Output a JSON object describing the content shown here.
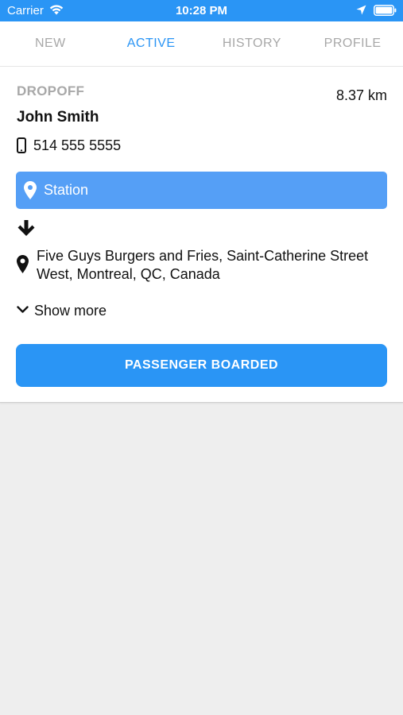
{
  "status_bar": {
    "carrier": "Carrier",
    "time": "10:28 PM",
    "background_color": "#2a95f5",
    "icons": [
      "wifi-icon",
      "location-arrow-icon",
      "battery-icon"
    ]
  },
  "tabs": [
    {
      "label": "NEW",
      "active": false
    },
    {
      "label": "ACTIVE",
      "active": true
    },
    {
      "label": "HISTORY",
      "active": false
    },
    {
      "label": "PROFILE",
      "active": false
    }
  ],
  "colors": {
    "accent": "#2a95f5",
    "pickup_bar": "#559ff6",
    "muted_text": "#a8a8a8",
    "background": "#eeeeee"
  },
  "ride": {
    "type_label": "DROPOFF",
    "distance": "8.37 km",
    "passenger_name": "John Smith",
    "phone": "514 555 5555",
    "pickup": "Station",
    "dropoff_address": "Five Guys Burgers and Fries, Saint-Catherine Street West, Montreal, QC, Canada",
    "show_more_label": "Show more",
    "action_label": "PASSENGER BOARDED",
    "icons": [
      "phone-icon",
      "map-pin-icon",
      "arrow-down-icon",
      "chevron-down-icon"
    ]
  }
}
